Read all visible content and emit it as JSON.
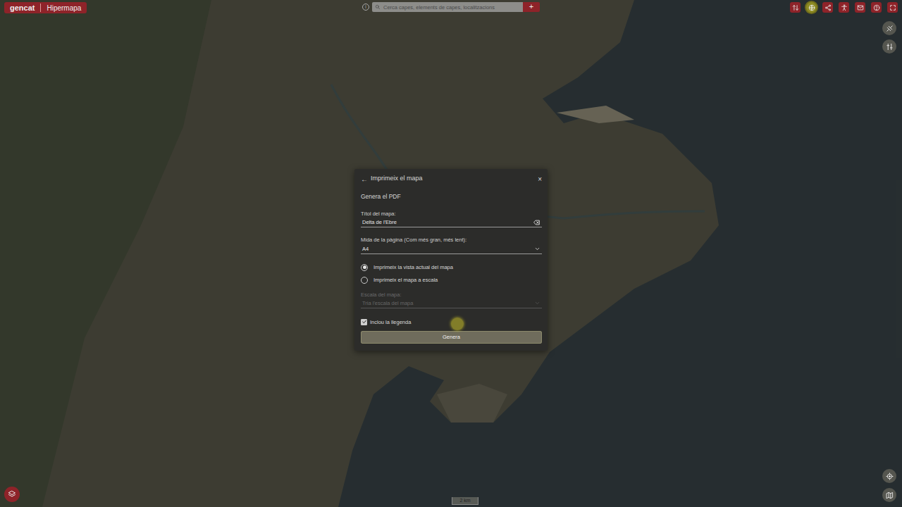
{
  "header": {
    "logo": "gencat",
    "app": "Hipermapa"
  },
  "search": {
    "placeholder": "Cerca capes, elements de capes, localitzacions",
    "info": "i",
    "add": "+"
  },
  "toolbar": [
    {
      "name": "swap",
      "highlighted": false
    },
    {
      "name": "globe",
      "highlighted": true
    },
    {
      "name": "share",
      "highlighted": false
    },
    {
      "name": "accessibility",
      "highlighted": false
    },
    {
      "name": "mail",
      "highlighted": false
    },
    {
      "name": "help",
      "highlighted": false
    },
    {
      "name": "fullscreen",
      "highlighted": false
    }
  ],
  "dialog": {
    "back": "←",
    "title": "Imprimeix el mapa",
    "close": "×",
    "subtitle": "Genera el PDF",
    "title_label": "Títol del mapa:",
    "title_value": "Delta de l'Ebre",
    "size_label": "Mida de la pàgina (Com més gran, més lent):",
    "size_value": "A4",
    "modes": [
      {
        "label": "Imprimeix la vista actual del mapa",
        "selected": true
      },
      {
        "label": "Imprimeix el mapa a escala",
        "selected": false
      }
    ],
    "scale_label": "Escala del mapa:",
    "scale_placeholder": "Tria l'escala del mapa",
    "scale_disabled": true,
    "legend": {
      "label": "Inclou la llegenda",
      "checked": true
    },
    "button": "Genera"
  },
  "scale_bar": "2 km"
}
